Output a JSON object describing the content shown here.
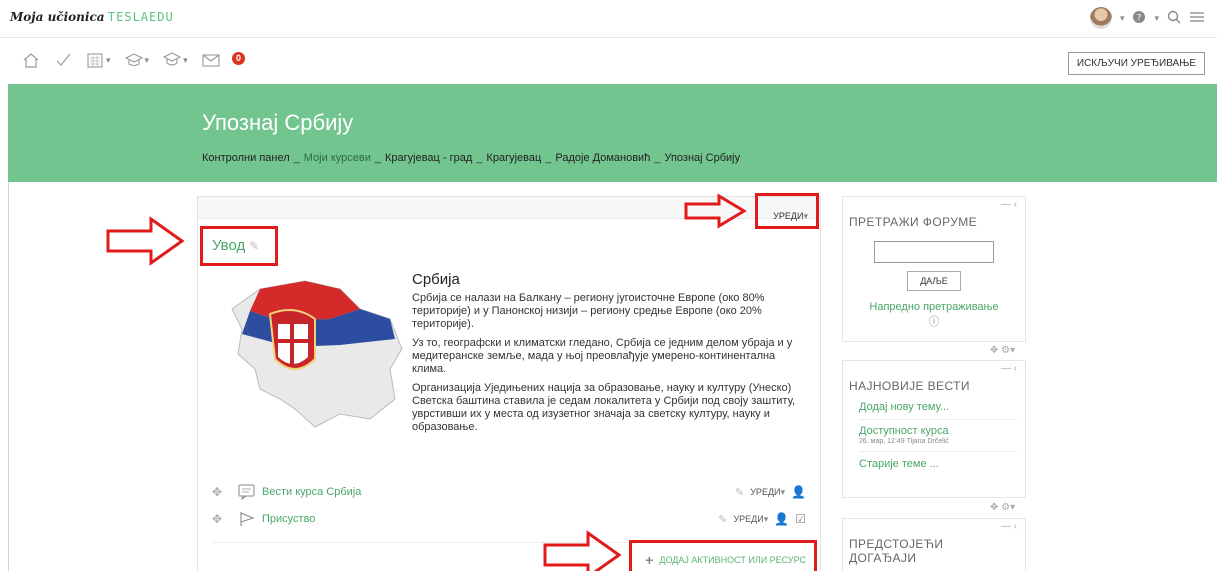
{
  "brand": {
    "script": "Moja učionica",
    "logo": "TESLAEDU"
  },
  "topbar": {
    "icons": [
      "avatar",
      "help-icon",
      "search-icon",
      "menu-icon"
    ]
  },
  "toolbar": {
    "icons": [
      "home-icon",
      "check-icon",
      "calendar-icon",
      "courses-icon",
      "graduation-icon",
      "mail-icon"
    ],
    "mail_badge": "0",
    "edit_mode_label": "ИСКЉУЧИ УРЕЂИВАЊЕ"
  },
  "header": {
    "title": "Упознај Србију",
    "breadcrumb": [
      "Контролни панел",
      "Моји курсеви",
      "Крагујевац - град",
      "Крагујевац",
      "Радоје Домановић",
      "Упознај Србију"
    ]
  },
  "section": {
    "edit_label": "УРЕДИ",
    "title": "Увод",
    "content_title": "Србија",
    "paragraphs": [
      "Србија се налази на Балкану – региону југоисточне Европе (око 80% територије) и у Панонској низији – региону средње Европе (око 20% територије).",
      "Уз то, географски и климатски гледано, Србија се једним делом убраја и у медитеранске земље, мада у њој преовлађује умерено-континентална клима.",
      "Организација Уједињених нација за образовање, науку и културу (Унеско) Светска баштина ставила је седам локалитета у Србији под своју заштиту, уврстивши их у места од изузетног значаја за светску културу, науку и образовање."
    ],
    "activities": [
      {
        "name": "Вести курса Србија",
        "edit": "УРЕДИ"
      },
      {
        "name": "Присуство",
        "edit": "УРЕДИ"
      }
    ],
    "add_activity": "ДОДАЈ АКТИВНОСТ ИЛИ РЕСУРС"
  },
  "blocks": {
    "search": {
      "title": "ПРЕТРАЖИ ФОРУМЕ",
      "button": "ДАЉЕ",
      "advanced": "Напредно претраживање"
    },
    "news": {
      "title": "НАЈНОВИЈЕ ВЕСТИ",
      "add_topic": "Додај нову тему...",
      "item_title": "Доступност курса",
      "item_meta": "26. мар, 12:49  Tijana Drčelić",
      "older": "Старије теме ..."
    },
    "upcoming": {
      "title": "ПРЕДСТОЈЕЋИ ДОГАЂАЈИ"
    }
  },
  "colors": {
    "accent": "#73c58f",
    "link": "#4aa66a",
    "annotation": "#e11b1b"
  }
}
